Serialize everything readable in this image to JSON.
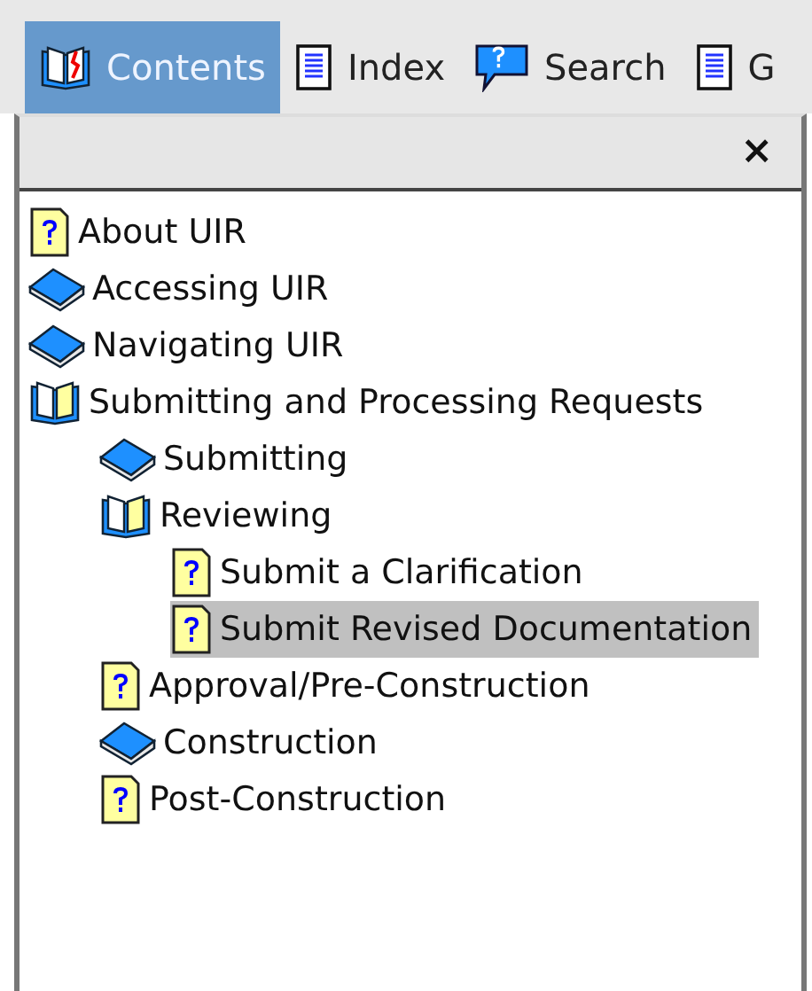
{
  "tabs": [
    {
      "label": "Contents",
      "kind": "contents",
      "selected": true
    },
    {
      "label": "Index",
      "kind": "index",
      "selected": false
    },
    {
      "label": "Search",
      "kind": "search",
      "selected": false
    },
    {
      "label": "G",
      "kind": "page",
      "selected": false
    }
  ],
  "pane": {
    "close": "×"
  },
  "tree": [
    {
      "kind": "topic",
      "label": "About UIR",
      "selected": false
    },
    {
      "kind": "book",
      "label": "Accessing UIR",
      "expanded": false
    },
    {
      "kind": "book",
      "label": "Navigating UIR",
      "expanded": false
    },
    {
      "kind": "book",
      "label": "Submitting and Processing Requests",
      "expanded": true,
      "children": [
        {
          "kind": "book",
          "label": "Submitting",
          "expanded": false
        },
        {
          "kind": "book",
          "label": "Reviewing",
          "expanded": true,
          "children": [
            {
              "kind": "topic",
              "label": "Submit a Clarification",
              "selected": false
            },
            {
              "kind": "topic",
              "label": "Submit Revised Documentation",
              "selected": true
            }
          ]
        },
        {
          "kind": "topic",
          "label": "Approval/Pre-Construction",
          "selected": false
        },
        {
          "kind": "book",
          "label": "Construction",
          "expanded": false
        },
        {
          "kind": "topic",
          "label": "Post-Construction",
          "selected": false
        }
      ]
    }
  ]
}
